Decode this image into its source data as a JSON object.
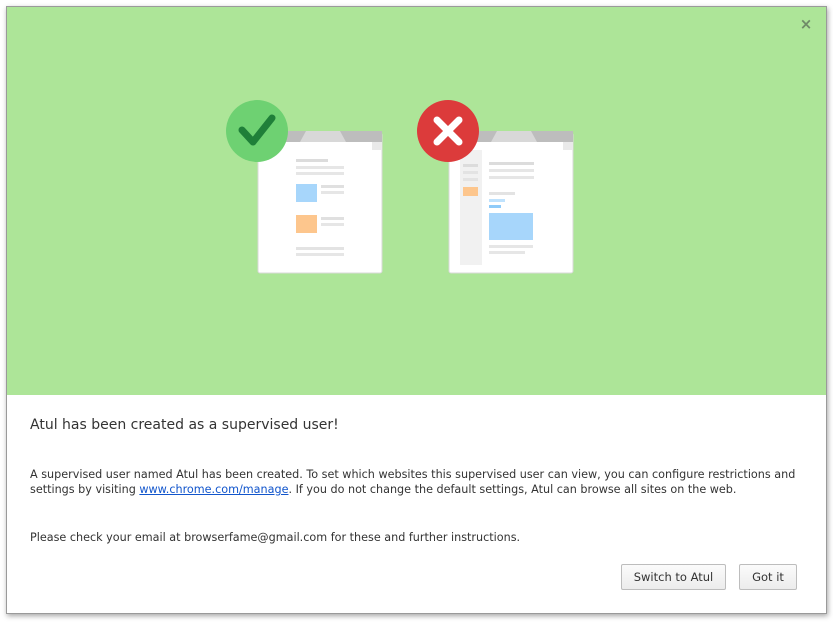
{
  "dialog": {
    "close_glyph": "×",
    "title": "Atul has been created as a supervised user!",
    "paragraph1": {
      "before_link": "A supervised user named Atul has been created. To set which websites this supervised user can view, you can configure restrictions and settings by visiting ",
      "link_text": "www.chrome.com/manage",
      "after_link": ". If you do not change the default settings, Atul can browse all sites on the web."
    },
    "paragraph2": "Please check your email at browserfame@gmail.com for these and further instructions.",
    "buttons": {
      "switch_label": "Switch to Atul",
      "gotit_label": "Got it"
    }
  },
  "illustration": {
    "allowed_icon": "checkmark-icon",
    "blocked_icon": "x-icon"
  },
  "colors": {
    "hero_background": "#ade598",
    "check_green": "#6ed172",
    "check_mark": "#1f7f39",
    "blocked_red": "#dc3b3b",
    "link_blue": "#1155cc"
  }
}
